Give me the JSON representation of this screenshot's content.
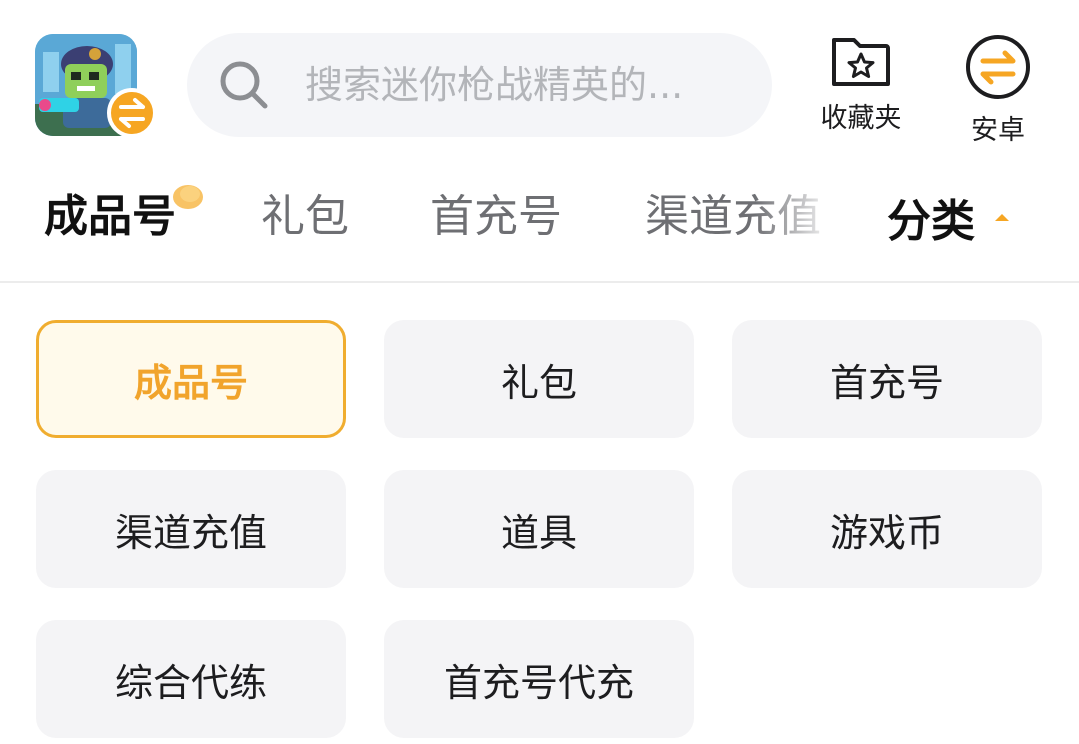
{
  "header": {
    "search_placeholder": "搜索迷你枪战精英的...",
    "actions": [
      {
        "label": "收藏夹",
        "icon": "star-folder-icon"
      },
      {
        "label": "安卓",
        "icon": "swap-arrows-icon"
      }
    ]
  },
  "tabs": [
    {
      "label": "成品号",
      "active": true,
      "badge": "hot-dot"
    },
    {
      "label": "礼包",
      "active": false
    },
    {
      "label": "首充号",
      "active": false
    },
    {
      "label": "渠道充值",
      "active": false
    }
  ],
  "category_toggle": {
    "label": "分类",
    "icon": "caret-up-icon"
  },
  "categories": [
    {
      "label": "成品号",
      "selected": true
    },
    {
      "label": "礼包",
      "selected": false
    },
    {
      "label": "首充号",
      "selected": false
    },
    {
      "label": "渠道充值",
      "selected": false
    },
    {
      "label": "道具",
      "selected": false
    },
    {
      "label": "游戏币",
      "selected": false
    },
    {
      "label": "综合代练",
      "selected": false
    },
    {
      "label": "首充号代充",
      "selected": false
    }
  ],
  "colors": {
    "accent": "#f6a623",
    "selected_border": "#f0ad2f",
    "selected_text": "#f1a42c",
    "chip_bg": "#f4f4f6"
  }
}
